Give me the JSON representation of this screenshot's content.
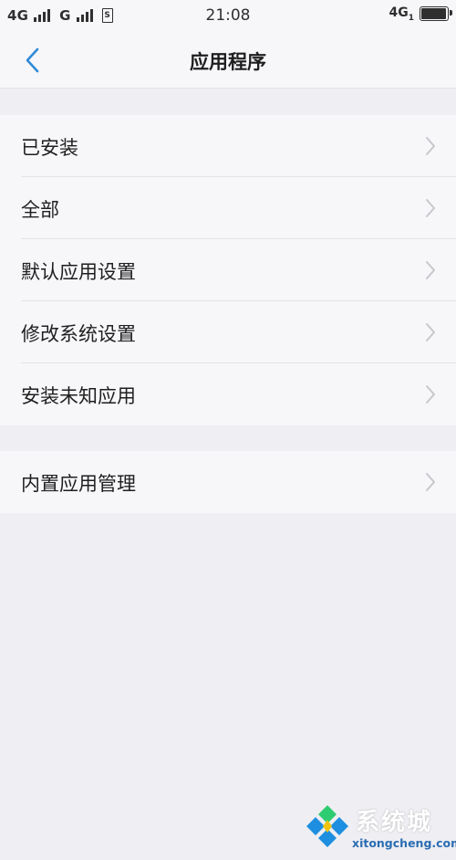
{
  "status_bar": {
    "sim1_network": "4G",
    "sim2_network": "G",
    "sim_icon": "S",
    "time": "21:08",
    "right_network": "4G",
    "right_network_sub": "1",
    "battery_level": 0.95
  },
  "nav": {
    "back_icon": "chevron-left-icon",
    "title": "应用程序"
  },
  "colors": {
    "accent": "#2f8ad6",
    "page_bg": "#efeef2",
    "card_bg": "#f7f6f9",
    "chevron": "#c7c7cc"
  },
  "section_1": {
    "items": [
      {
        "label": "已安装"
      },
      {
        "label": "全部"
      },
      {
        "label": "默认应用设置"
      },
      {
        "label": "修改系统设置"
      },
      {
        "label": "安装未知应用"
      }
    ]
  },
  "section_2": {
    "items": [
      {
        "label": "内置应用管理"
      }
    ]
  },
  "watermark": {
    "text": "系统城",
    "url": "xitongcheng.com"
  }
}
